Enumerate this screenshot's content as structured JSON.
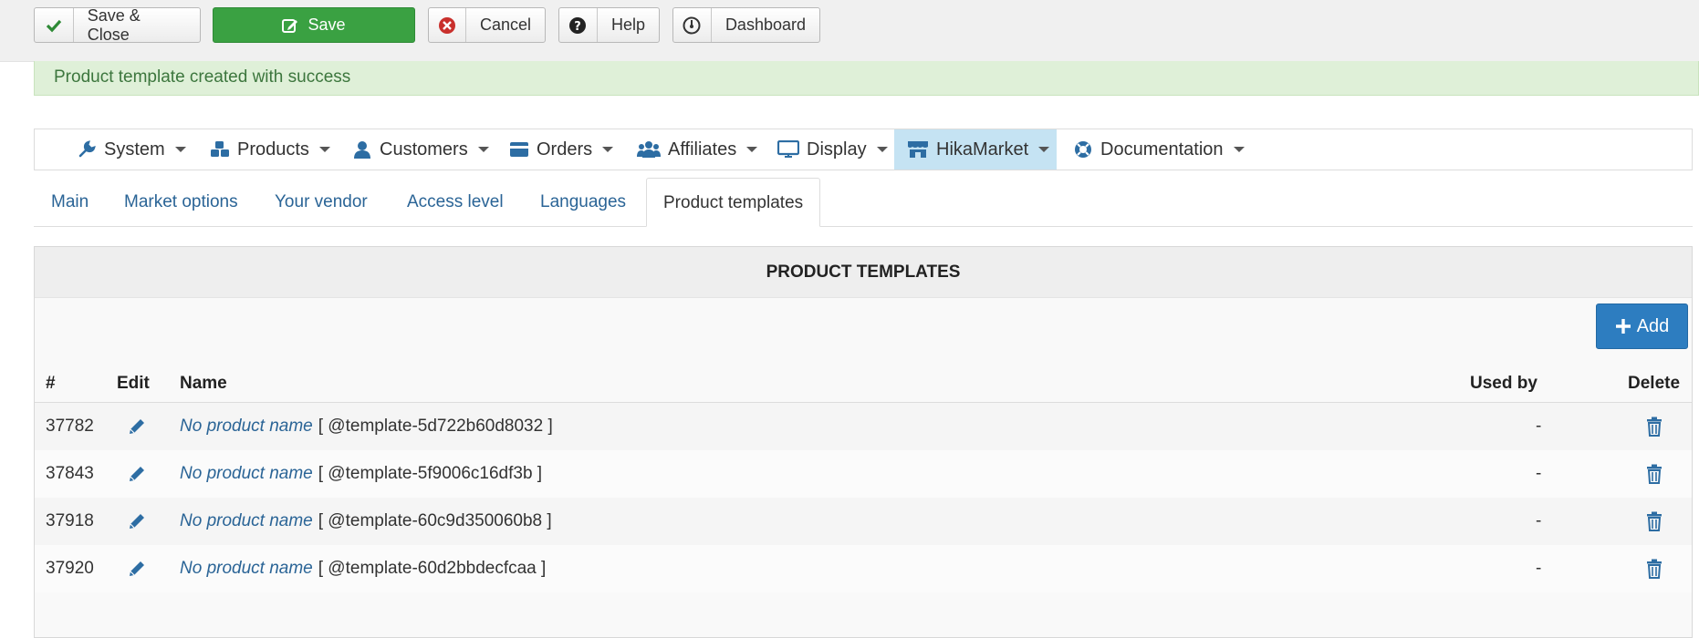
{
  "toolbar": {
    "save_close": "Save & Close",
    "save": "Save",
    "cancel": "Cancel",
    "help": "Help",
    "dashboard": "Dashboard"
  },
  "alert": {
    "message": "Product template created with success"
  },
  "menu": {
    "items": [
      {
        "label": "System",
        "icon": "wrench-icon"
      },
      {
        "label": "Products",
        "icon": "cubes-icon"
      },
      {
        "label": "Customers",
        "icon": "user-icon"
      },
      {
        "label": "Orders",
        "icon": "credit-card-icon"
      },
      {
        "label": "Affiliates",
        "icon": "users-icon"
      },
      {
        "label": "Display",
        "icon": "monitor-icon"
      },
      {
        "label": "HikaMarket",
        "icon": "store-icon"
      },
      {
        "label": "Documentation",
        "icon": "lifebuoy-icon"
      }
    ]
  },
  "tabs": [
    "Main",
    "Market options",
    "Your vendor",
    "Access level",
    "Languages",
    "Product templates"
  ],
  "panel": {
    "title": "PRODUCT TEMPLATES",
    "add_label": "Add",
    "columns": {
      "id": "#",
      "edit": "Edit",
      "name": "Name",
      "used_by": "Used by",
      "delete": "Delete"
    },
    "rows": [
      {
        "id": "37782",
        "name": "No product name",
        "code": "[ @template-5d722b60d8032 ]",
        "used_by": "-"
      },
      {
        "id": "37843",
        "name": "No product name",
        "code": "[ @template-5f9006c16df3b ]",
        "used_by": "-"
      },
      {
        "id": "37918",
        "name": "No product name",
        "code": "[ @template-60c9d350060b8 ]",
        "used_by": "-"
      },
      {
        "id": "37920",
        "name": "No product name",
        "code": "[ @template-60d2bbdecfcaa ]",
        "used_by": "-"
      }
    ]
  },
  "colors": {
    "save_green": "#3aa142",
    "link_blue": "#2a6496",
    "add_blue": "#2d7dc0",
    "success_bg": "#dff0d8"
  }
}
